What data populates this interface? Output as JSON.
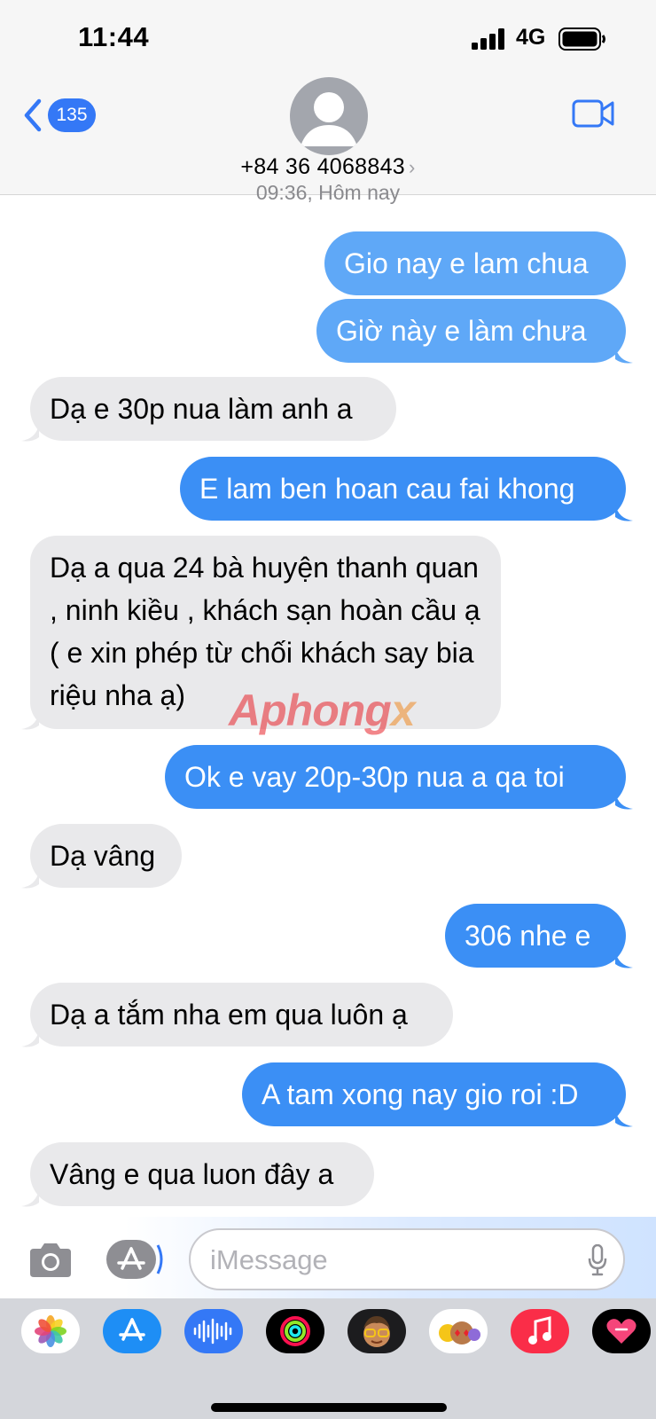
{
  "status_bar": {
    "time": "11:44",
    "network": "4G"
  },
  "header": {
    "unread_count": "135",
    "contact": "+84 36 4068843"
  },
  "timestamp": "09:36, Hôm nay",
  "messages": [
    {
      "dir": "out",
      "text": "Gio nay e lam chua"
    },
    {
      "dir": "out",
      "text": "Giờ này e làm chưa"
    },
    {
      "dir": "in",
      "text": "Dạ e 30p nua làm anh a"
    },
    {
      "dir": "out",
      "text": "E lam ben hoan cau fai khong"
    },
    {
      "dir": "in",
      "text": "Dạ a qua 24 bà huyện thanh quan , ninh kiều , khách sạn hoàn cầu ạ ( e xin phép từ chối khách say bia riệu nha ạ)"
    },
    {
      "dir": "out",
      "text": "Ok e vay 20p-30p nua a qa toi"
    },
    {
      "dir": "in",
      "text": "Dạ vâng"
    },
    {
      "dir": "out",
      "text": "306 nhe e"
    },
    {
      "dir": "in",
      "text": "Dạ a tắm nha em qua luôn ạ"
    },
    {
      "dir": "out",
      "text": "A tam xong nay gio roi :D"
    },
    {
      "dir": "in",
      "text": "Vâng e qua luon đây a"
    }
  ],
  "composer": {
    "placeholder": "iMessage"
  },
  "app_drawer": [
    "photos-app",
    "app-store-app",
    "audio-message-app",
    "activity-app",
    "memoji-app",
    "animoji-app",
    "music-app",
    "digital-touch-app"
  ],
  "watermark": {
    "main": "Aphong",
    "accent": "x"
  },
  "colors": {
    "outgoing": "#3b8ff5",
    "incoming": "#e9e9eb",
    "accent": "#3478f6"
  }
}
